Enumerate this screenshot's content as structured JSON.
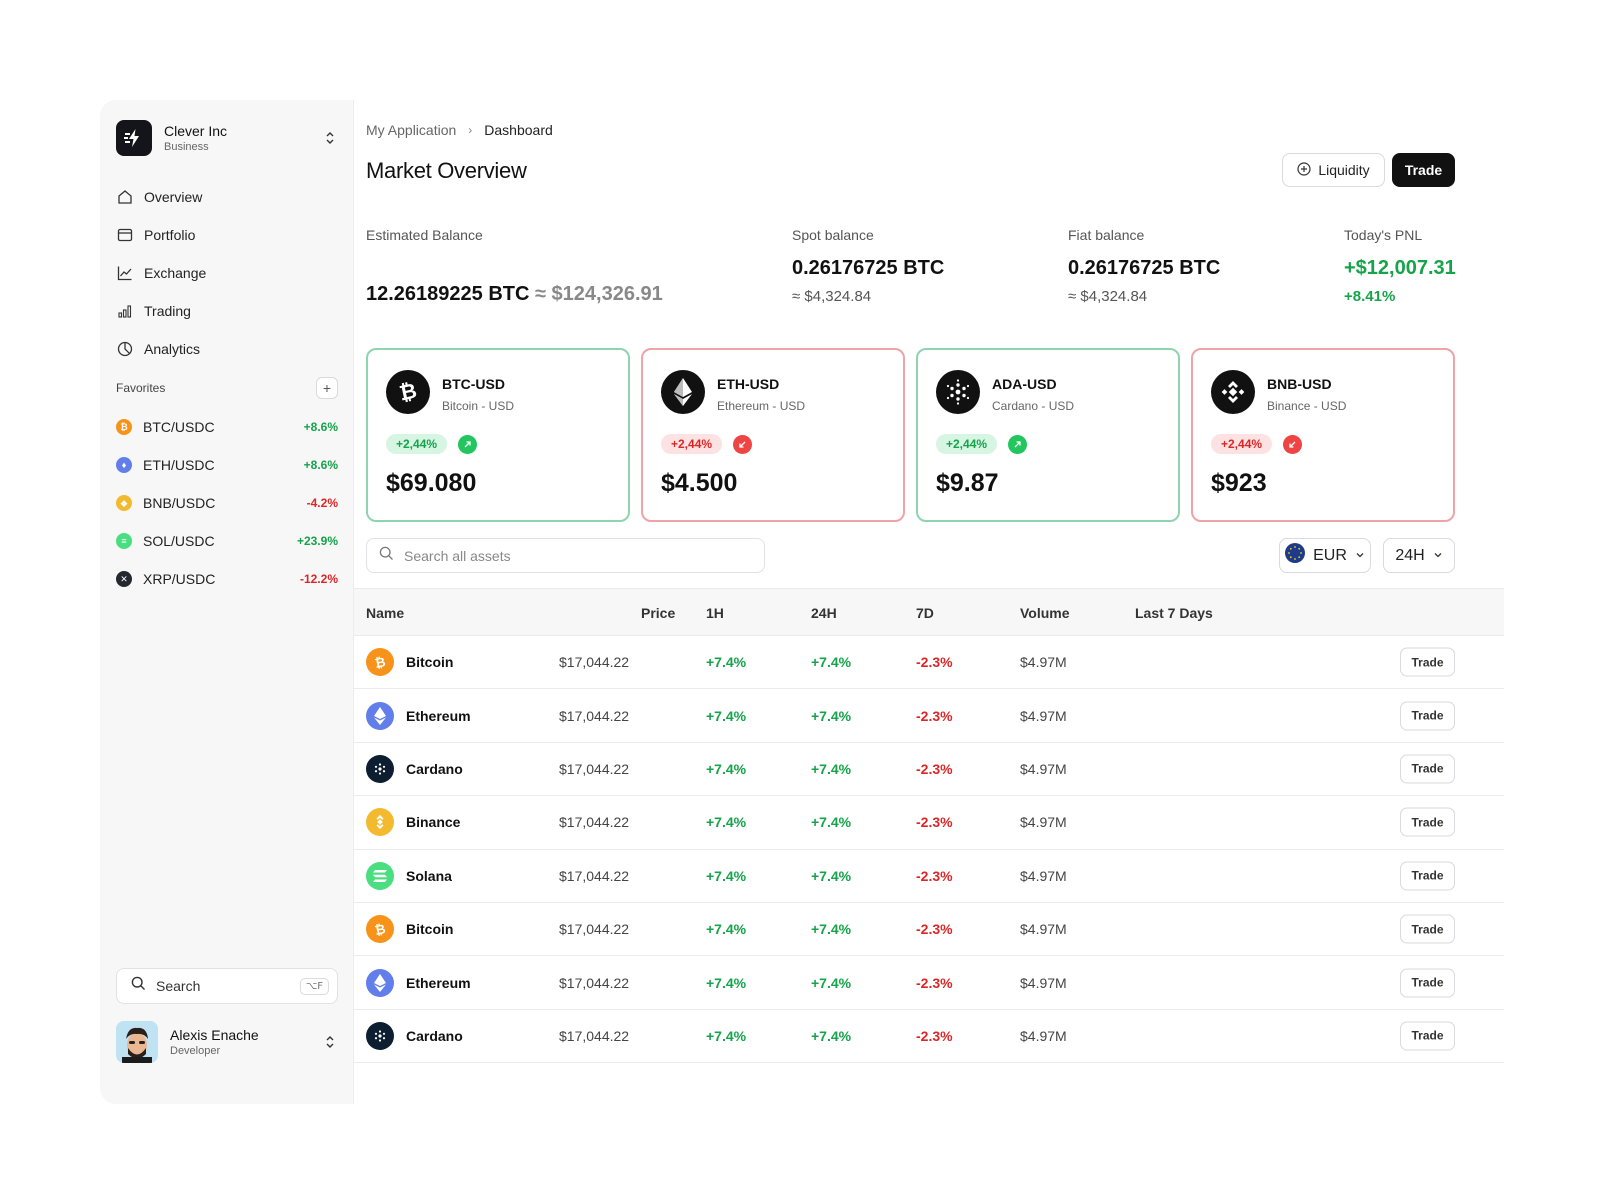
{
  "org": {
    "name": "Clever Inc",
    "plan": "Business"
  },
  "nav": [
    {
      "label": "Overview",
      "icon": "home-icon"
    },
    {
      "label": "Portfolio",
      "icon": "portfolio-icon"
    },
    {
      "label": "Exchange",
      "icon": "line-chart-icon"
    },
    {
      "label": "Trading",
      "icon": "bar-chart-icon"
    },
    {
      "label": "Analytics",
      "icon": "pie-chart-icon"
    }
  ],
  "favorites": {
    "title": "Favorites",
    "items": [
      {
        "pair": "BTC/USDC",
        "change": "+8.6%",
        "dir": "up",
        "color": "#F7931A"
      },
      {
        "pair": "ETH/USDC",
        "change": "+8.6%",
        "dir": "up",
        "color": "#627EEA"
      },
      {
        "pair": "BNB/USDC",
        "change": "-4.2%",
        "dir": "down",
        "color": "#F3BA2F"
      },
      {
        "pair": "SOL/USDC",
        "change": "+23.9%",
        "dir": "up",
        "color": "#4ADE80"
      },
      {
        "pair": "XRP/USDC",
        "change": "-12.2%",
        "dir": "down",
        "color": "#23292F"
      }
    ]
  },
  "side_search": {
    "label": "Search",
    "shortcut": "⌥F"
  },
  "user": {
    "name": "Alexis Enache",
    "role": "Developer"
  },
  "breadcrumb": {
    "root": "My Application",
    "current": "Dashboard"
  },
  "page_title": "Market Overview",
  "actions": {
    "liquidity": "Liquidity",
    "trade": "Trade"
  },
  "balances": {
    "estimated": {
      "label": "Estimated Balance",
      "btc": "12.26189225 BTC",
      "approx": "≈ $124,326.91"
    },
    "spot": {
      "label": "Spot balance",
      "value": "0.26176725 BTC",
      "sub": "≈ $4,324.84"
    },
    "fiat": {
      "label": "Fiat balance",
      "value": "0.26176725 BTC",
      "sub": "≈ $4,324.84"
    },
    "pnl": {
      "label": "Today's PNL",
      "value": "+$12,007.31",
      "sub": "+8.41%"
    }
  },
  "cards": [
    {
      "pair": "BTC-USD",
      "sub": "Bitcoin - USD",
      "pill": "+2,44%",
      "dir": "up",
      "price": "$69.080",
      "icon": "bitcoin-icon"
    },
    {
      "pair": "ETH-USD",
      "sub": "Ethereum - USD",
      "pill": "+2,44%",
      "dir": "down",
      "price": "$4.500",
      "icon": "ethereum-icon"
    },
    {
      "pair": "ADA-USD",
      "sub": "Cardano - USD",
      "pill": "+2,44%",
      "dir": "up",
      "price": "$9.87",
      "icon": "cardano-icon"
    },
    {
      "pair": "BNB-USD",
      "sub": "Binance - USD",
      "pill": "+2,44%",
      "dir": "down",
      "price": "$923",
      "icon": "binance-icon"
    }
  ],
  "search": {
    "placeholder": "Search all assets"
  },
  "currency": {
    "selected": "EUR"
  },
  "period": {
    "selected": "24H"
  },
  "table": {
    "columns": [
      "Name",
      "Price",
      "1H",
      "24H",
      "7D",
      "Volume",
      "Last 7 Days"
    ],
    "trade_label": "Trade",
    "rows": [
      {
        "name": "Bitcoin",
        "price": "$17,044.22",
        "h1": "+7.4%",
        "h24": "+7.4%",
        "d7": "-2.3%",
        "volume": "$4.97M",
        "coin": "btc",
        "color": "#F7931A"
      },
      {
        "name": "Ethereum",
        "price": "$17,044.22",
        "h1": "+7.4%",
        "h24": "+7.4%",
        "d7": "-2.3%",
        "volume": "$4.97M",
        "coin": "eth",
        "color": "#627EEA"
      },
      {
        "name": "Cardano",
        "price": "$17,044.22",
        "h1": "+7.4%",
        "h24": "+7.4%",
        "d7": "-2.3%",
        "volume": "$4.97M",
        "coin": "ada",
        "color": "#0D1E30"
      },
      {
        "name": "Binance",
        "price": "$17,044.22",
        "h1": "+7.4%",
        "h24": "+7.4%",
        "d7": "-2.3%",
        "volume": "$4.97M",
        "coin": "bnb",
        "color": "#F3BA2F"
      },
      {
        "name": "Solana",
        "price": "$17,044.22",
        "h1": "+7.4%",
        "h24": "+7.4%",
        "d7": "-2.3%",
        "volume": "$4.97M",
        "coin": "sol",
        "color": "#4ADE80"
      },
      {
        "name": "Bitcoin",
        "price": "$17,044.22",
        "h1": "+7.4%",
        "h24": "+7.4%",
        "d7": "-2.3%",
        "volume": "$4.97M",
        "coin": "btc",
        "color": "#F7931A"
      },
      {
        "name": "Ethereum",
        "price": "$17,044.22",
        "h1": "+7.4%",
        "h24": "+7.4%",
        "d7": "-2.3%",
        "volume": "$4.97M",
        "coin": "eth",
        "color": "#627EEA"
      },
      {
        "name": "Cardano",
        "price": "$17,044.22",
        "h1": "+7.4%",
        "h24": "+7.4%",
        "d7": "-2.3%",
        "volume": "$4.97M",
        "coin": "ada",
        "color": "#0D1E30"
      }
    ]
  },
  "colors": {
    "up": "#16A34A",
    "down": "#DC2626",
    "accent": "#111111"
  }
}
